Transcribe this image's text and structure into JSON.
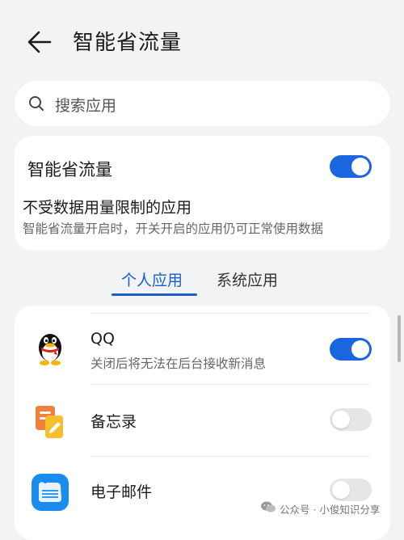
{
  "header": {
    "title": "智能省流量"
  },
  "search": {
    "placeholder": "搜索应用"
  },
  "smart_saver": {
    "label": "智能省流量",
    "enabled": true,
    "section_title": "不受数据用量限制的应用",
    "section_description": "智能省流量开启时，开关开启的应用仍可正常使用数据"
  },
  "tabs": [
    {
      "label": "个人应用",
      "active": true
    },
    {
      "label": "系统应用",
      "active": false
    }
  ],
  "apps": [
    {
      "name": "QQ",
      "subtitle": "关闭后将无法在后台接收新消息",
      "enabled": true,
      "icon": "qq-penguin-icon"
    },
    {
      "name": "备忘录",
      "subtitle": "",
      "enabled": false,
      "icon": "memo-icon"
    },
    {
      "name": "电子邮件",
      "subtitle": "",
      "enabled": false,
      "icon": "email-icon"
    }
  ],
  "watermark": {
    "text": "公众号 · 小俊知识分享"
  },
  "colors": {
    "accent": "#1a66e0",
    "background": "#f1f3f5",
    "card": "#ffffff",
    "toggle_off": "#e6e6e6"
  }
}
